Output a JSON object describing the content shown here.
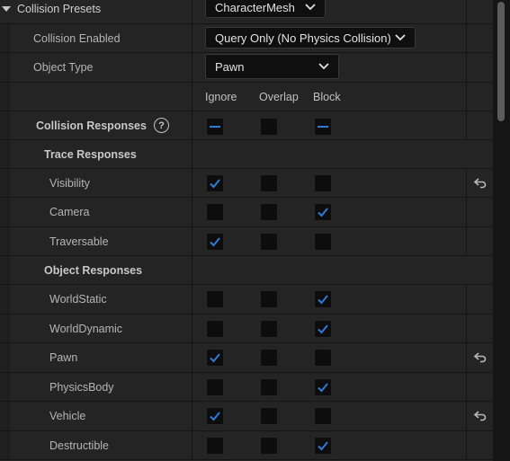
{
  "preset": {
    "label": "Collision Presets",
    "value": "CharacterMesh"
  },
  "collision_enabled": {
    "label": "Collision Enabled",
    "value": "Query Only (No Physics Collision)"
  },
  "object_type": {
    "label": "Object Type",
    "value": "Pawn"
  },
  "columns": {
    "ignore": "Ignore",
    "overlap": "Overlap",
    "block": "Block"
  },
  "collision_responses": {
    "label": "Collision Responses",
    "help_glyph": "?"
  },
  "trace_section": "Trace Responses",
  "object_section": "Object Responses",
  "accent_color": "#2d7bd6",
  "trace_rows": [
    {
      "label": "Visibility",
      "state": "ignore",
      "reset": true
    },
    {
      "label": "Camera",
      "state": "block",
      "reset": false
    },
    {
      "label": "Traversable",
      "state": "ignore",
      "reset": false
    }
  ],
  "object_rows": [
    {
      "label": "WorldStatic",
      "state": "block",
      "reset": false
    },
    {
      "label": "WorldDynamic",
      "state": "block",
      "reset": false
    },
    {
      "label": "Pawn",
      "state": "ignore",
      "reset": true
    },
    {
      "label": "PhysicsBody",
      "state": "block",
      "reset": false
    },
    {
      "label": "Vehicle",
      "state": "ignore",
      "reset": true
    },
    {
      "label": "Destructible",
      "state": "block",
      "reset": false
    }
  ]
}
